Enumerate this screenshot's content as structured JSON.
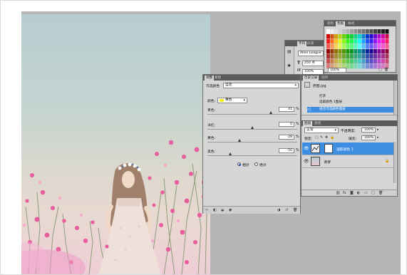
{
  "type_panel": {
    "tabs": [
      "字符",
      "段落"
    ],
    "font": "Allen League",
    "size": "250 点",
    "scale": "100%"
  },
  "swatches": {
    "tabs": [
      "颜色",
      "色板",
      "样式"
    ],
    "scale": "100%"
  },
  "adjustments": {
    "tabs": [
      "调整",
      "蒙版"
    ],
    "title": "可选颜色",
    "preset": "自定",
    "color_label": "颜色:",
    "color_value": "黄色",
    "rows": [
      {
        "label": "青色:",
        "value": "41",
        "pct": "%"
      },
      {
        "label": "洋红:",
        "value": "0",
        "pct": "%"
      },
      {
        "label": "黄色:",
        "value": "-28",
        "pct": "%"
      },
      {
        "label": "黑色:",
        "value": "-50",
        "pct": "%"
      }
    ],
    "slider_levels_percent": [
      41,
      0,
      -28,
      -50
    ],
    "radio_relative": "相对",
    "radio_absolute": "绝对"
  },
  "history": {
    "tabs": [
      "历史记录",
      "动作"
    ],
    "snapshot": "原图.jpg",
    "items": [
      "打开",
      "选取颜色 1图层",
      "组合可选颜色图层"
    ]
  },
  "layers": {
    "tabs": [
      "图层",
      "通道"
    ],
    "blend_mode": "正常",
    "opacity_label": "不透明度:",
    "opacity_value": "100%",
    "lock_label": "锁定:",
    "fill_label": "填充:",
    "fill_value": "100%",
    "items": [
      {
        "name": "选取颜色 1"
      },
      {
        "name": "背景"
      }
    ]
  },
  "colors": {
    "selection": "#3d8ee2",
    "panel": "#d6d6d6",
    "tabbar": "#5a5a5a",
    "workspace": "#b5b5b5",
    "yellow_chip": "#f5ef1a"
  }
}
